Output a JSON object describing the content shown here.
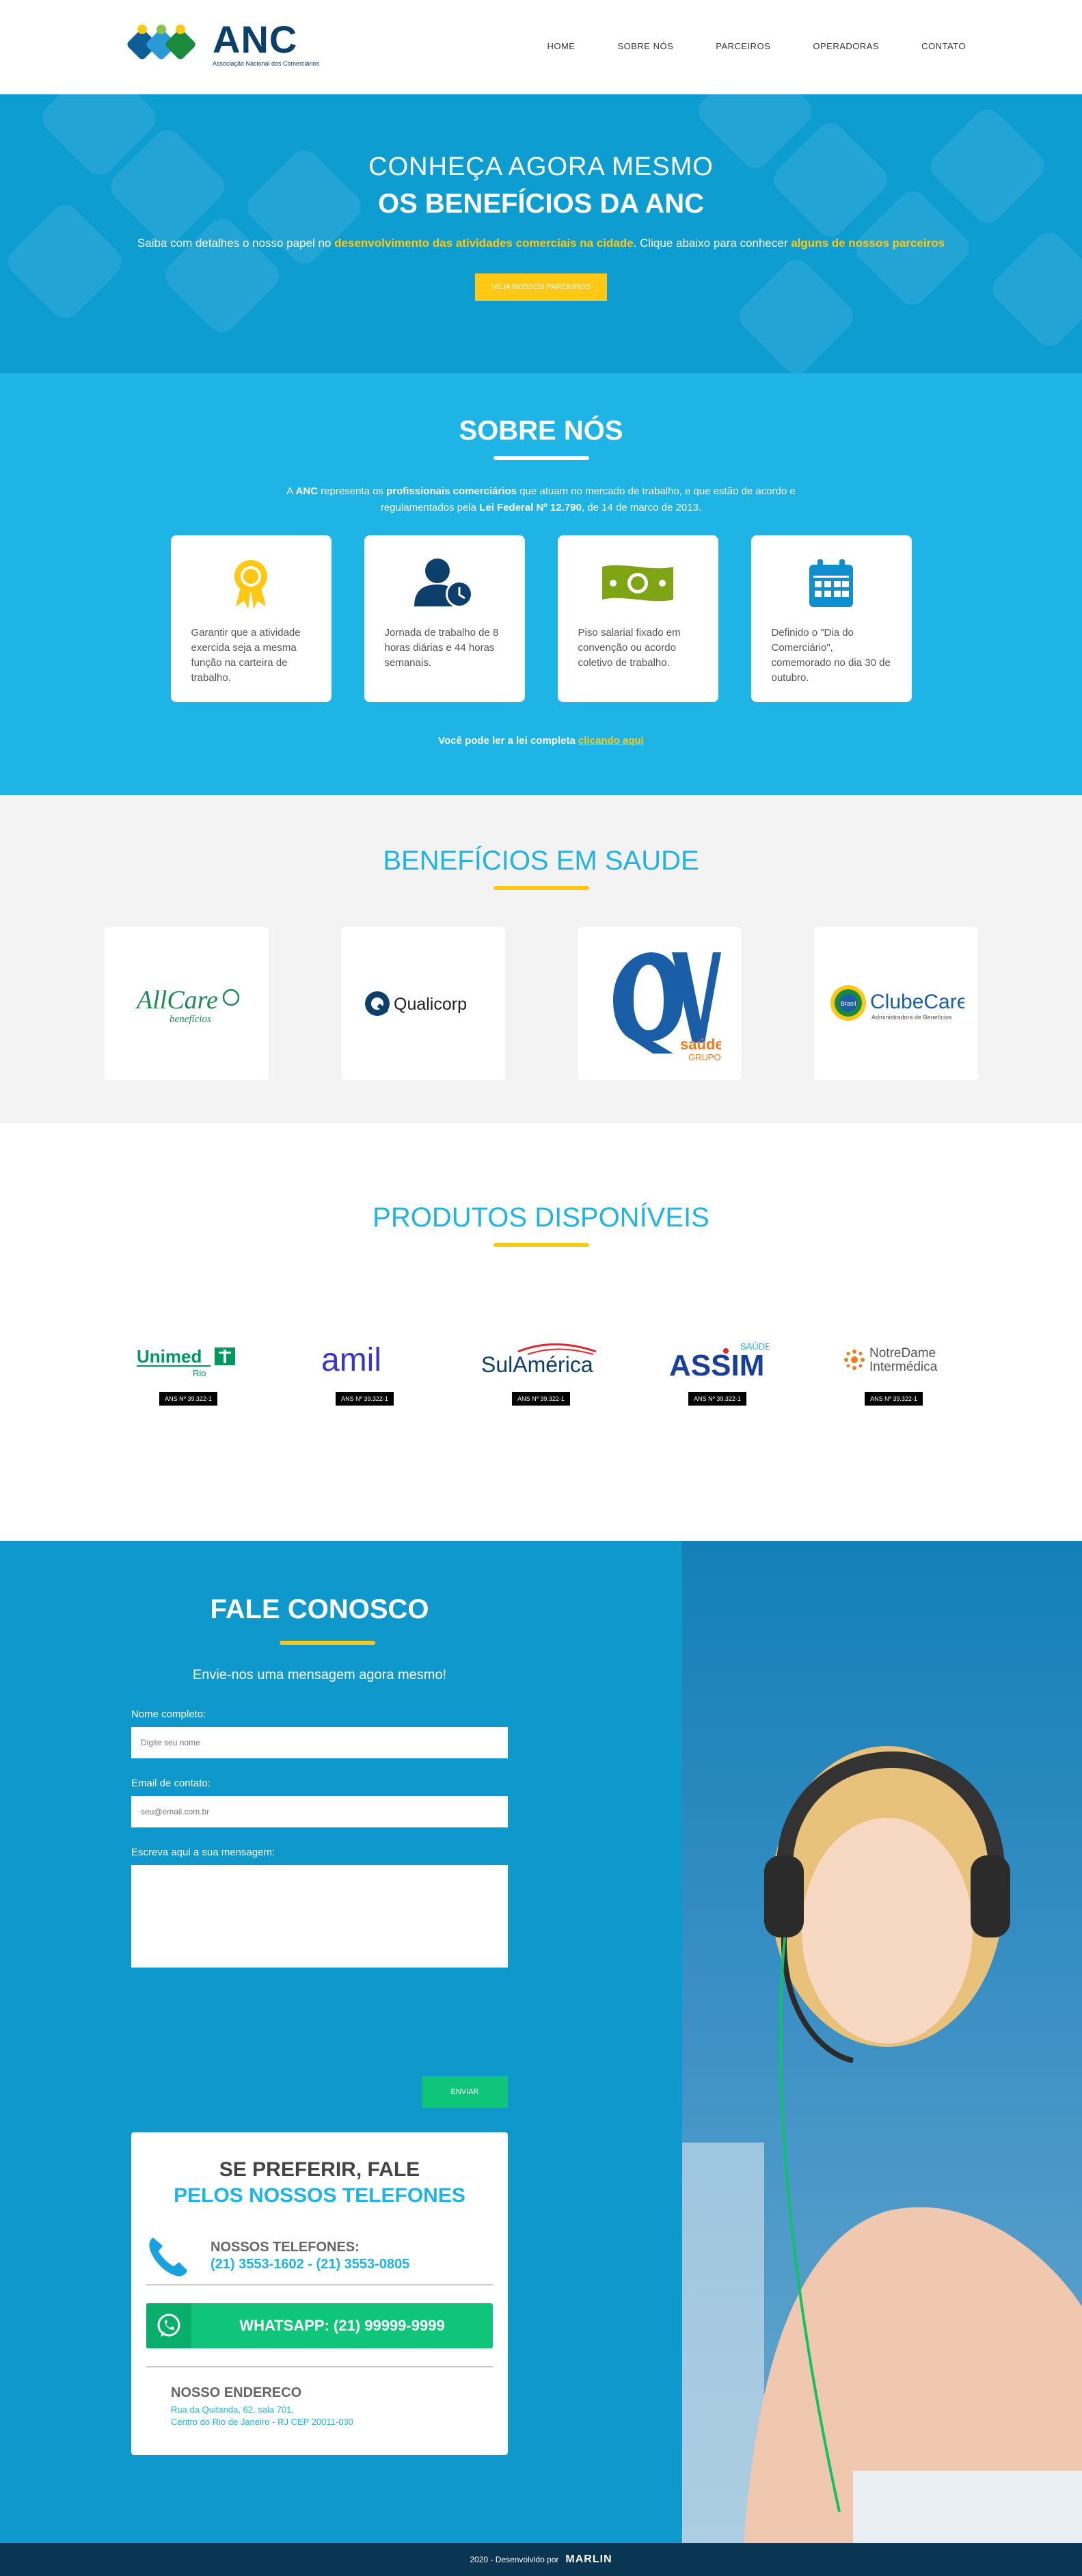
{
  "nav": {
    "logo_name": "ANC",
    "logo_sub": "Associação Nacional dos Comerciários",
    "items": [
      "HOME",
      "SOBRE NÓS",
      "PARCEIROS",
      "OPERADORAS",
      "CONTATO"
    ]
  },
  "hero": {
    "line1": "CONHEÇA AGORA MESMO",
    "line2": "OS BENEFÍCIOS DA ANC",
    "p_a": "Saiba com detalhes o nosso papel no ",
    "p_hl1": "desenvolvimento das atividades comerciais na cidade",
    "p_b": ". Clique abaixo para conhecer ",
    "p_hl2": "alguns de nossos parceiros",
    "button": "VEJA NOSSOS PARCEIROS"
  },
  "sobre": {
    "title": "SOBRE NÓS",
    "t1": "A ",
    "t2": "ANC",
    "t3": " representa os ",
    "t4": "profissionais comerciários",
    "t5": " que atuam no mercado de trabalho, e que estão de acordo e",
    "t6": "regulamentados pela ",
    "t7": "Lei Federal Nº 12.790",
    "t8": ", de 14 de marco de 2013.",
    "cards": [
      "Garantir que a atividade exercida seja a mesma função na carteira de trabalho.",
      "Jornada de trabalho de 8 horas diárias e 44 horas semanais.",
      "Piso salarial fixado em convenção ou acordo coletivo de trabalho.",
      "Definido o \"Dia do Comerciário\", comemorado no dia 30 de outubro."
    ],
    "note": "Você pode ler a lei completa ",
    "note_link": "clicando aqui"
  },
  "beneficios": {
    "title": "BENEFÍCIOS EM SAUDE",
    "allcare": "AllCare",
    "allcare_sub": "benefícios",
    "qualicorp": "Qualicorp",
    "qv_saude": "saúde",
    "qv_grupo": "GRUPO",
    "clubecare": "ClubeCare",
    "clubecare_sub": "Administradora de Benefícios",
    "clubecare_flag": "Brasil"
  },
  "produtos": {
    "title": "PRODUTOS DISPONÍVEIS",
    "unimed": "Unimed",
    "unimed_sub": "Rio",
    "amil": "amil",
    "sulamerica": "SulAmérica",
    "assim": "ASSIM",
    "assim_sub": "SAÚDE",
    "notredame1": "NotreDame",
    "notredame2": "Intermédica",
    "ans": [
      "ANS Nº 39.322-1",
      "ANS Nº 39.322-1",
      "ANS Nº 39.322-1",
      "ANS Nº 39.322-1",
      "ANS Nº 39.322-1"
    ]
  },
  "contato": {
    "title": "FALE CONOSCO",
    "subtitle": "Envie-nos uma mensagem agora mesmo!",
    "name_label": "Nome completo:",
    "name_placeholder": "Digite seu nome",
    "email_label": "Email de contato:",
    "email_placeholder": "seu@email.com.br",
    "msg_label": "Escreva aqui a sua mensagem:",
    "send": "ENVIAR",
    "tel_title1": "SE PREFERIR, FALE",
    "tel_title2": "PELOS NOSSOS TELEFONES",
    "tel_label": "NOSSOS TELEFONES:",
    "tel_nums": "(21) 3553-1602 - (21) 3553-0805",
    "whatsapp": "WHATSAPP: (21) 99999-9999",
    "end_label": "NOSSO ENDERECO",
    "end_line1": "Rua da Quitanda, 62, sala 701,",
    "end_line2": "Centro do Rio de Janeiro - RJ CEP 20011-030"
  },
  "footer": {
    "text": "2020 - Desenvolvido por",
    "brand": "MARLIN"
  }
}
